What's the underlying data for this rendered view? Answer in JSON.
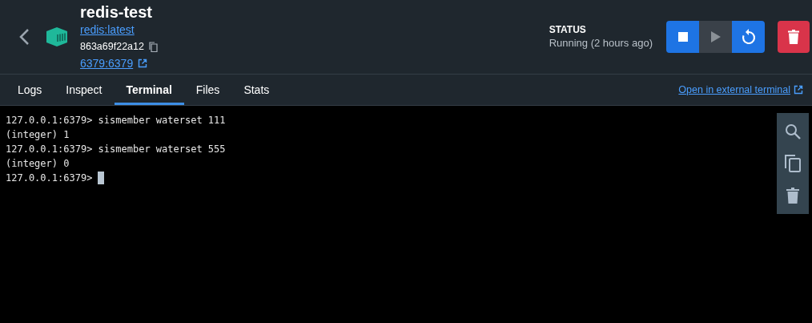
{
  "container": {
    "name": "redis-test",
    "image": "redis:latest",
    "id": "863a69f22a12",
    "ports": "6379:6379"
  },
  "status": {
    "label": "STATUS",
    "value": "Running (2 hours ago)"
  },
  "actions": [
    {
      "kind": "stop",
      "disabled": false
    },
    {
      "kind": "start",
      "disabled": true
    },
    {
      "kind": "restart",
      "disabled": false
    }
  ],
  "tabs": [
    {
      "label": "Logs",
      "selected": false
    },
    {
      "label": "Inspect",
      "selected": false
    },
    {
      "label": "Terminal",
      "selected": true
    },
    {
      "label": "Files",
      "selected": false
    },
    {
      "label": "Stats",
      "selected": false
    }
  ],
  "external_link": "Open in external terminal",
  "terminal": {
    "lines": [
      {
        "text": "127.0.0.1:6379> sismember waterset 111",
        "cursor": false
      },
      {
        "text": "(integer) 1",
        "cursor": false
      },
      {
        "text": "127.0.0.1:6379> sismember waterset 555",
        "cursor": false
      },
      {
        "text": "(integer) 0",
        "cursor": false
      },
      {
        "text": "127.0.0.1:6379>",
        "cursor": true
      }
    ]
  }
}
